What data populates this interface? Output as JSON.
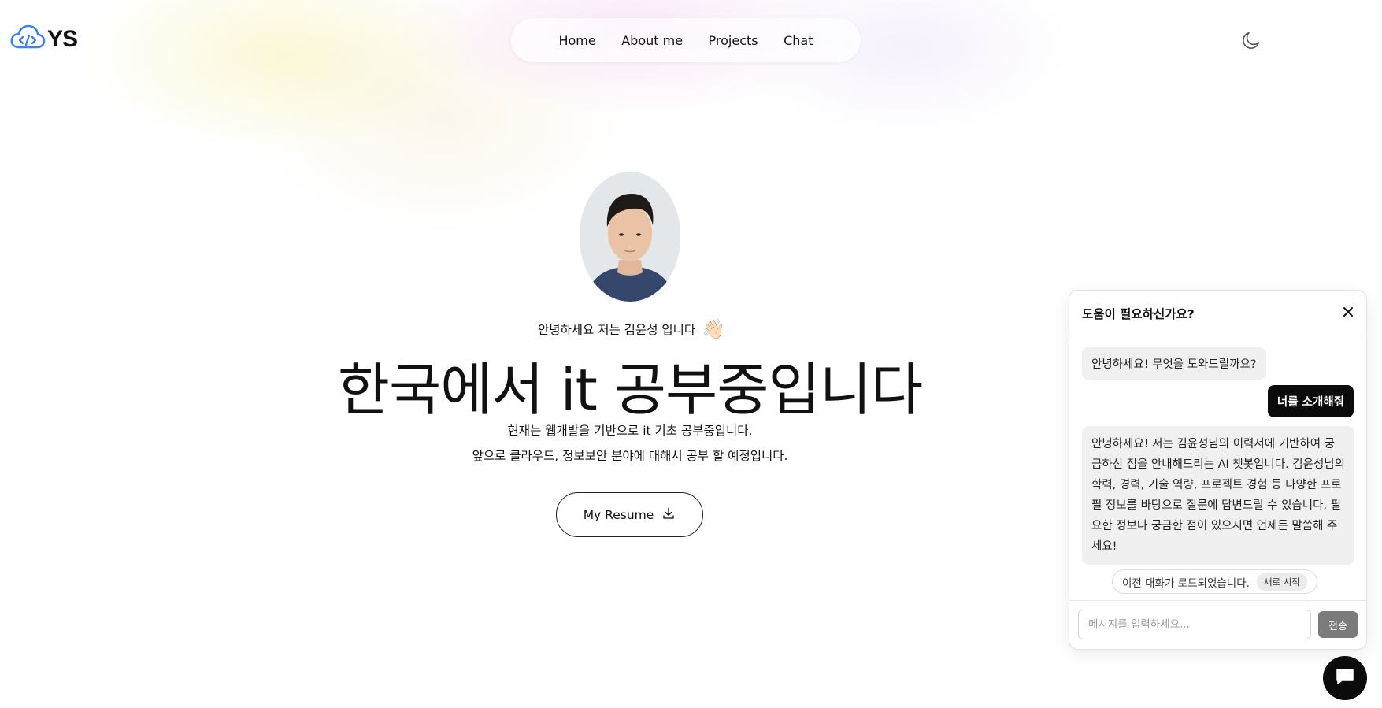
{
  "logo": {
    "text": "YS",
    "icon": "cloud-code-icon"
  },
  "nav": {
    "items": [
      {
        "label": "Home"
      },
      {
        "label": "About me"
      },
      {
        "label": "Projects"
      },
      {
        "label": "Chat"
      }
    ]
  },
  "theme_toggle": {
    "icon": "moon-icon"
  },
  "hero": {
    "avatar": "profile-photo",
    "greeting": "안녕하세요 저는 김윤성 입니다",
    "wave": "👋🏻",
    "headline": "한국에서 it 공부중입니다",
    "description": [
      "현재는 웹개발을 기반으로 it 기초 공부중입니다.",
      "앞으로 클라우드, 정보보안 분야에 대해서 공부 할 예정입니다."
    ],
    "resume_button": "My Resume",
    "resume_icon": "download-icon"
  },
  "chat": {
    "title": "도움이 필요하신가요?",
    "messages": [
      {
        "role": "bot",
        "text": "안녕하세요! 무엇을 도와드릴까요?"
      },
      {
        "role": "user",
        "text": "너를 소개해줘"
      },
      {
        "role": "bot",
        "text": "안녕하세요! 저는 김윤성님의 이력서에 기반하여 궁금하신 점을 안내해드리는 AI 챗봇입니다. 김윤성님의 학력, 경력, 기술 역량, 프로젝트 경험 등 다양한 프로필 정보를 바탕으로 질문에 답변드릴 수 있습니다. 필요한 정보나 궁금한 점이 있으시면 언제든 말씀해 주세요!"
      }
    ],
    "status": "이전 대화가 로드되었습니다.",
    "restart_label": "새로 시작",
    "input_placeholder": "메시지를 입력하세요...",
    "send_label": "전송"
  },
  "colors": {
    "accent_blue": "#3b82f6",
    "dark": "#0b0b0b",
    "send_disabled": "#7b7b7b"
  }
}
